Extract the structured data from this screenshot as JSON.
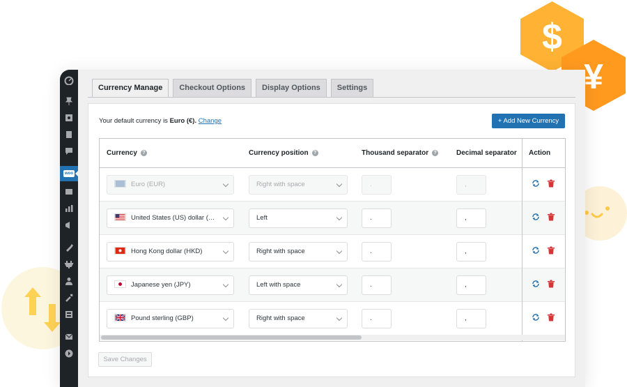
{
  "tabs": [
    {
      "label": "Currency Manage",
      "active": true
    },
    {
      "label": "Checkout Options",
      "active": false
    },
    {
      "label": "Display Options",
      "active": false
    },
    {
      "label": "Settings",
      "active": false
    }
  ],
  "default_currency": {
    "prefix": "Your default currency is ",
    "value": "Euro (€).",
    "change_label": "Change"
  },
  "add_button_label": "+ Add New Currency",
  "table": {
    "headers": {
      "currency": "Currency",
      "position": "Currency position",
      "thousand": "Thousand separator",
      "decimal": "Decimal separator",
      "action": "Action"
    },
    "rows": [
      {
        "currency": "Euro (EUR)",
        "flag": "eu",
        "position": "Right with space",
        "thousand": ".",
        "decimal": ",",
        "disabled": true
      },
      {
        "currency": "United States (US) dollar (USD)",
        "flag": "us",
        "position": "Left",
        "thousand": ".",
        "decimal": ",",
        "disabled": false
      },
      {
        "currency": "Hong Kong dollar (HKD)",
        "flag": "hk",
        "position": "Right with space",
        "thousand": ".",
        "decimal": ",",
        "disabled": false
      },
      {
        "currency": "Japanese yen (JPY)",
        "flag": "jp",
        "position": "Left with space",
        "thousand": ".",
        "decimal": ",",
        "disabled": false
      },
      {
        "currency": "Pound sterling (GBP)",
        "flag": "gb",
        "position": "Right with space",
        "thousand": ".",
        "decimal": ",",
        "disabled": false
      }
    ]
  },
  "save_button_label": "Save Changes",
  "sidebar_woo_label": "woo",
  "decor": {
    "dollar_symbol": "$",
    "yen_symbol": "¥"
  },
  "colors": {
    "accent": "#2271b1",
    "delete": "#d63638",
    "hex_orange": "#ffb233",
    "hex_deep_orange": "#ff9a1f"
  }
}
